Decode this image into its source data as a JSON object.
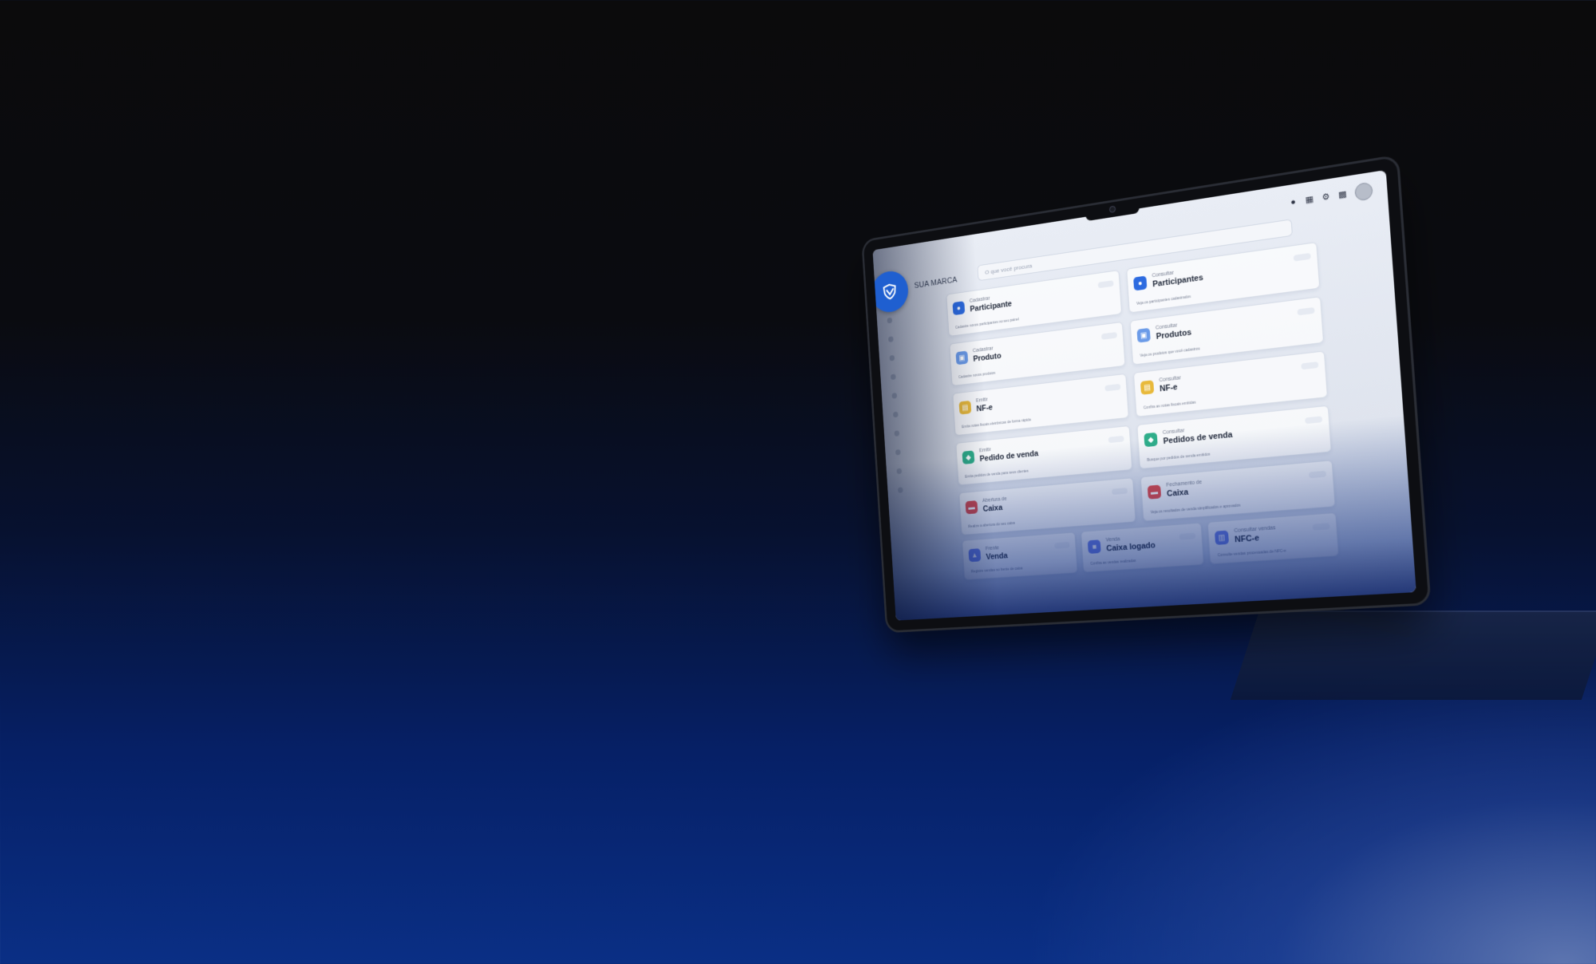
{
  "app": {
    "brand_name": "SUA MARCA",
    "search_placeholder": "O que você procura",
    "accent_color": "#1f5fd0",
    "top_icons": [
      "bell-icon",
      "calendar-icon",
      "gear-icon",
      "apps-grid-icon",
      "avatar"
    ]
  },
  "sidebar": {
    "items": [
      "nav-dot-1",
      "nav-dot-2",
      "nav-dot-3",
      "nav-dot-4",
      "nav-dot-5",
      "nav-dot-6",
      "nav-dot-7",
      "nav-dot-8",
      "nav-dot-9",
      "nav-dot-10"
    ]
  },
  "cards": [
    {
      "kicker": "Cadastrar",
      "title": "Participante",
      "desc": "Cadastre novos participantes no seu painel",
      "icon": "user-icon",
      "color": "#2d6be0"
    },
    {
      "kicker": "Consultar",
      "title": "Participantes",
      "desc": "Veja os participantes cadastrados",
      "icon": "user-icon",
      "color": "#2d6be0"
    },
    {
      "kicker": "Cadastrar",
      "title": "Produto",
      "desc": "Cadastre novos produtos",
      "icon": "box-icon",
      "color": "#6b9be8"
    },
    {
      "kicker": "Consultar",
      "title": "Produtos",
      "desc": "Veja os produtos que você cadastrou",
      "icon": "box-icon",
      "color": "#6b9be8"
    },
    {
      "kicker": "Emitir",
      "title": "NF-e",
      "desc": "Emita notas fiscais eletrônicas de forma rápida",
      "icon": "document-icon",
      "color": "#e8b93b"
    },
    {
      "kicker": "Consultar",
      "title": "NF-e",
      "desc": "Confira as notas fiscais emitidas",
      "icon": "document-icon",
      "color": "#e8b93b"
    },
    {
      "kicker": "Emitir",
      "title": "Pedido de venda",
      "desc": "Emita pedidos de venda para seus clientes",
      "icon": "tag-icon",
      "color": "#2fae8a"
    },
    {
      "kicker": "Consultar",
      "title": "Pedidos de venda",
      "desc": "Busque por pedidos de venda emitidos",
      "icon": "tag-icon",
      "color": "#2fae8a"
    },
    {
      "kicker": "Abertura de",
      "title": "Caixa",
      "desc": "Realize a abertura do seu caixa",
      "icon": "cash-icon",
      "color": "#e04a4a"
    },
    {
      "kicker": "Fechamento de",
      "title": "Caixa",
      "desc": "Veja os resultados de venda simplificados e aprovados",
      "icon": "cash-icon",
      "color": "#e04a4a"
    }
  ],
  "bottom_cards": [
    {
      "kicker": "Frente",
      "title": "Venda",
      "desc": "Registre vendas no frente de caixa",
      "icon": "cart-icon",
      "color": "#6b7fe8"
    },
    {
      "kicker": "Venda",
      "title": "Caixa logado",
      "desc": "Confira as vendas realizadas",
      "icon": "register-icon",
      "color": "#6b7fe8"
    },
    {
      "kicker": "Consultar vendas",
      "title": "NFC-e",
      "desc": "Consulte vendas processadas de NFC-e",
      "icon": "receipt-icon",
      "color": "#6b7fe8"
    }
  ]
}
